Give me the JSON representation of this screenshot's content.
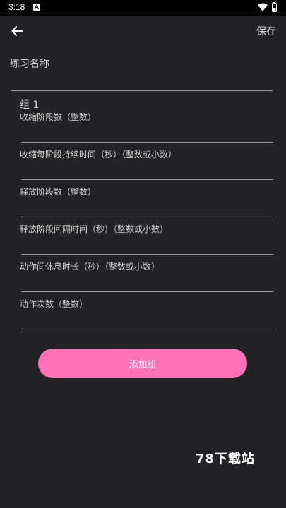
{
  "status_bar": {
    "time": "3:18"
  },
  "toolbar": {
    "back_icon": "arrow-left-icon",
    "save_label": "保存"
  },
  "form": {
    "name_label": "练习名称",
    "name_value": "",
    "group": {
      "title": "组 1",
      "fields": [
        {
          "label": "收缩阶段数（整数）",
          "value": ""
        },
        {
          "label": "收缩每阶段持续时间（秒）（整数或小数）",
          "value": ""
        },
        {
          "label": "释放阶段数（整数）",
          "value": ""
        },
        {
          "label": "释放阶段间隔时间（秒）（整数或小数）",
          "value": ""
        },
        {
          "label": "动作间休息时长（秒）（整数或小数）",
          "value": ""
        },
        {
          "label": "动作次数（整数）",
          "value": ""
        }
      ]
    },
    "add_group_label": "添加组"
  },
  "watermark": "78下载站",
  "colors": {
    "background": "#222326",
    "accent": "#ff72b6",
    "status_bar": "#000000"
  }
}
